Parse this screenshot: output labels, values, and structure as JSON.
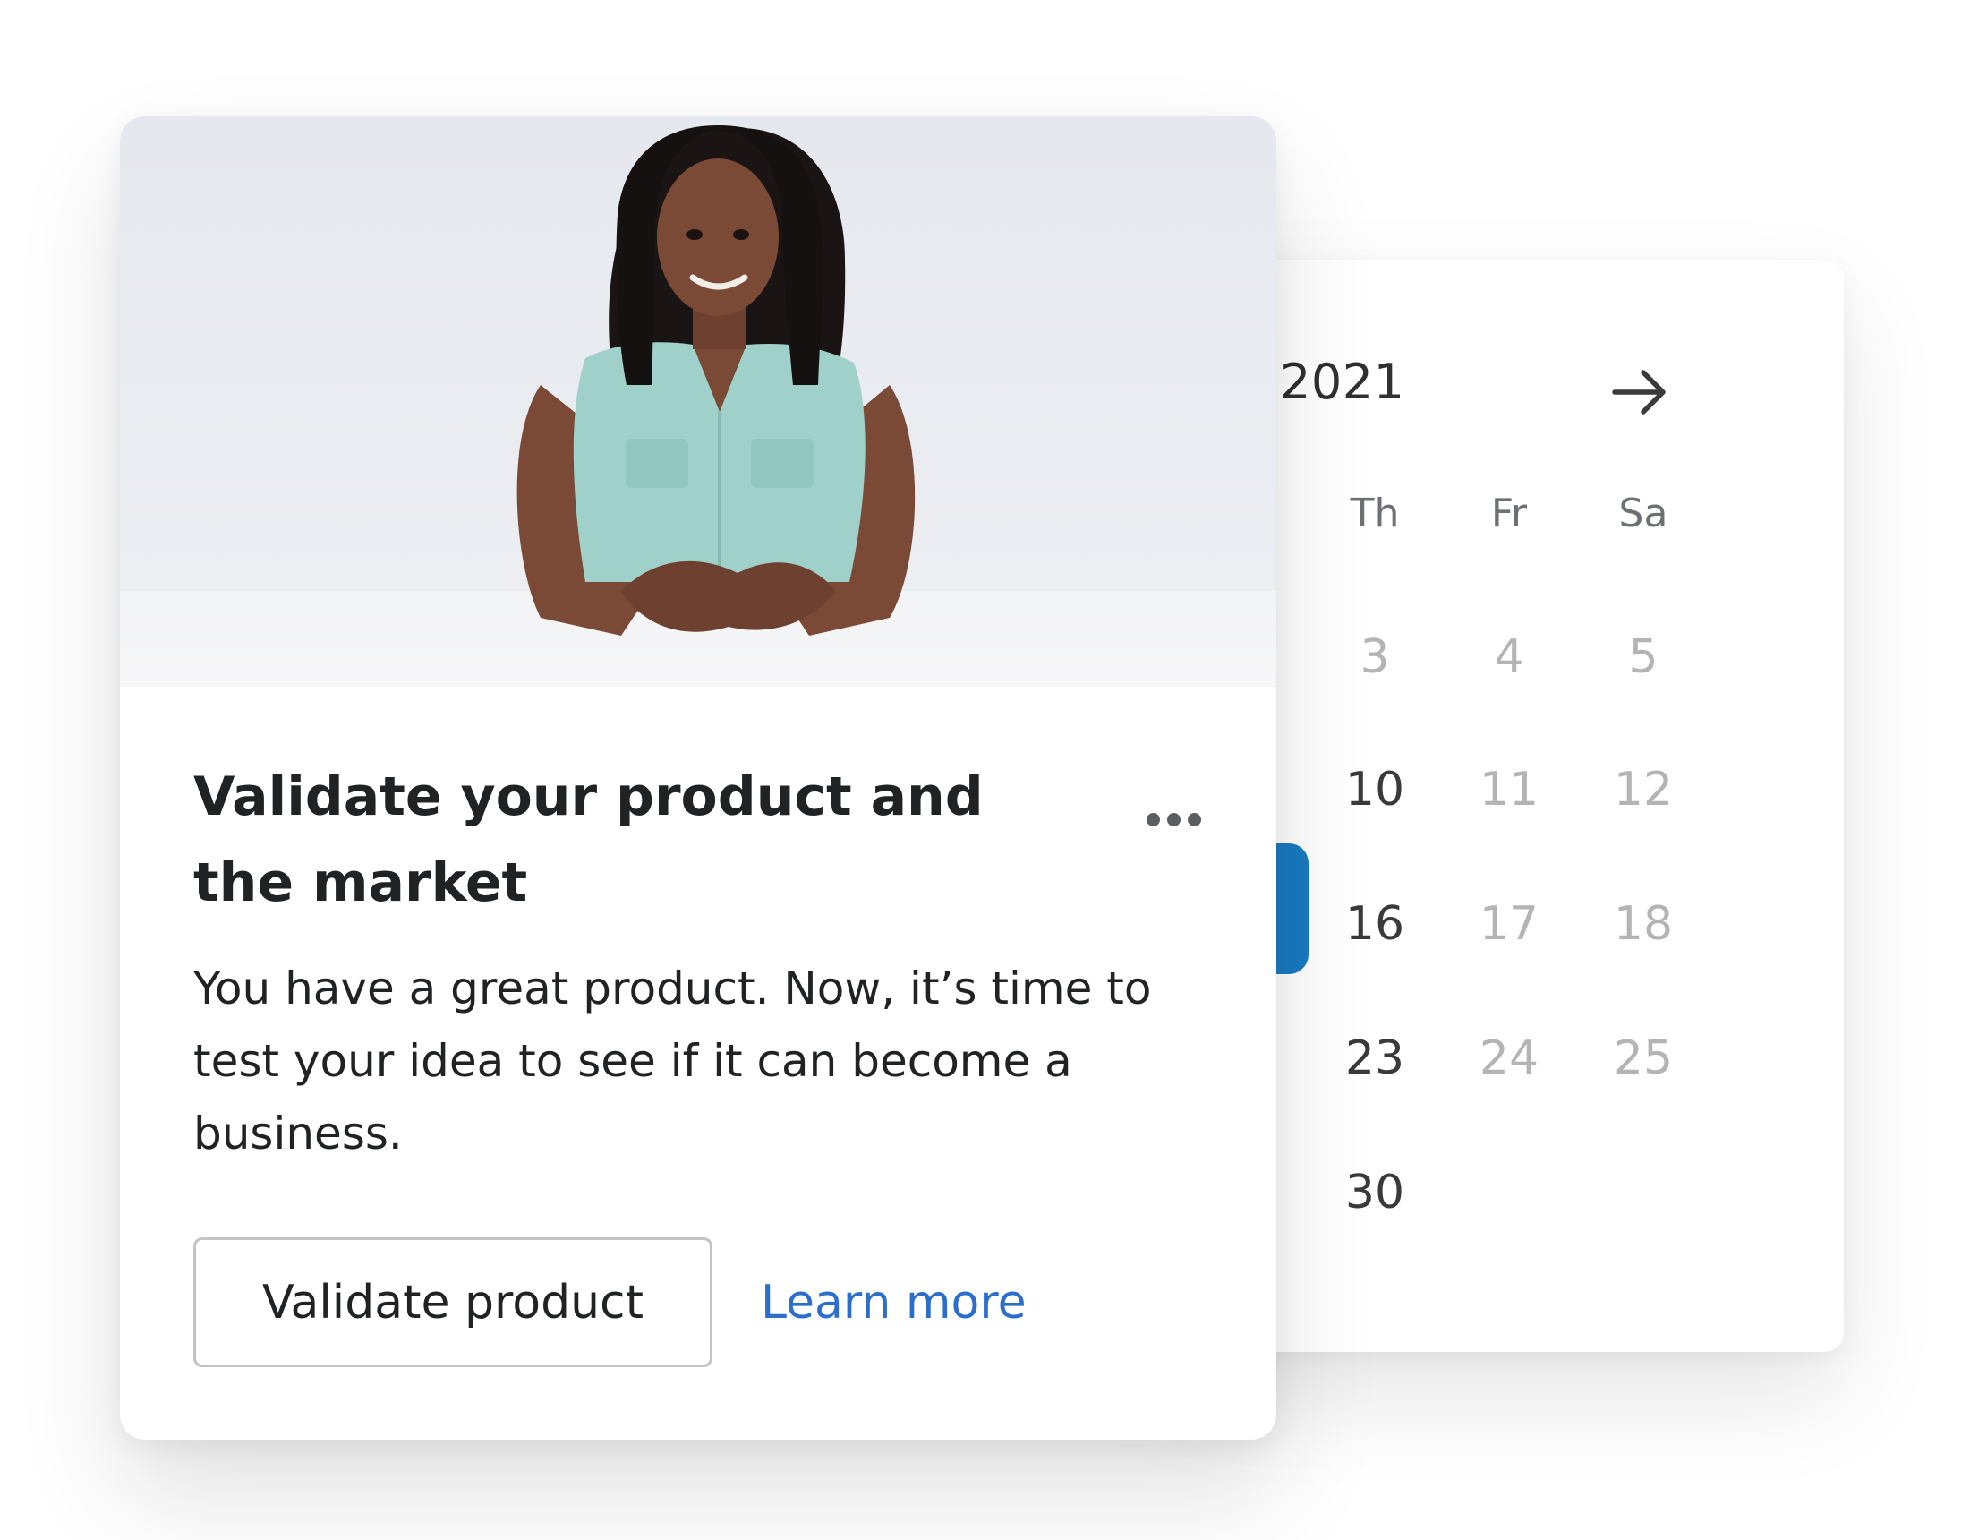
{
  "calendar": {
    "year": "2021",
    "next_icon": "arrow-right-icon",
    "weekdays": [
      "Th",
      "Fr",
      "Sa"
    ],
    "weeks": [
      [
        {
          "day": "3",
          "state": "muted"
        },
        {
          "day": "4",
          "state": "muted"
        },
        {
          "day": "5",
          "state": "muted"
        }
      ],
      [
        {
          "day": "10",
          "state": "active"
        },
        {
          "day": "11",
          "state": "muted"
        },
        {
          "day": "12",
          "state": "muted"
        }
      ],
      [
        {
          "day": "16",
          "state": "active"
        },
        {
          "day": "17",
          "state": "muted"
        },
        {
          "day": "18",
          "state": "muted"
        }
      ],
      [
        {
          "day": "23",
          "state": "active"
        },
        {
          "day": "24",
          "state": "muted"
        },
        {
          "day": "25",
          "state": "muted"
        }
      ],
      [
        {
          "day": "30",
          "state": "active"
        }
      ]
    ],
    "selected_color": "#1a7ac1"
  },
  "card": {
    "title": "Validate your product and the market",
    "body": "You have a great product. Now, it’s time to test your idea to see if it can become a business.",
    "more_icon": "horizontal-dots-icon",
    "primary_action": "Validate product",
    "secondary_action": "Learn more",
    "link_color": "#2c6ecb"
  }
}
